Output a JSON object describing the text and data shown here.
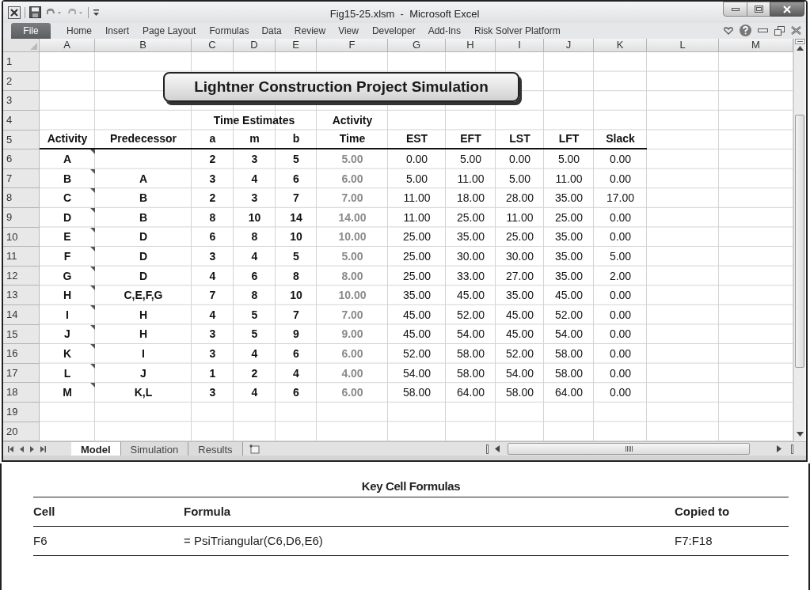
{
  "window": {
    "title": "Fig15-25.xlsm  -  Microsoft Excel"
  },
  "ribbon": {
    "file_tab": "File",
    "tabs": [
      "Home",
      "Insert",
      "Page Layout",
      "Formulas",
      "Data",
      "Review",
      "View",
      "Developer",
      "Add-Ins",
      "Risk Solver Platform"
    ]
  },
  "sheet": {
    "columns": [
      "A",
      "B",
      "C",
      "D",
      "E",
      "F",
      "G",
      "H",
      "I",
      "J",
      "K",
      "L",
      "M"
    ],
    "row_numbers": [
      "1",
      "2",
      "3",
      "4",
      "5",
      "6",
      "7",
      "8",
      "9",
      "10",
      "11",
      "12",
      "13",
      "14",
      "15",
      "16",
      "17",
      "18",
      "19",
      "20"
    ],
    "title_box": "Lightner Construction Project Simulation",
    "header_groups": [
      "Time Estimates",
      "Activity"
    ],
    "headers": [
      "Activity",
      "Predecessor",
      "a",
      "m",
      "b",
      "Time",
      "EST",
      "EFT",
      "LST",
      "LFT",
      "Slack"
    ],
    "data_rows": [
      {
        "activity": "A",
        "a": "2",
        "m": "3",
        "b": "5",
        "time": "5.00",
        "est": "0.00",
        "eft": "5.00",
        "lst": "0.00",
        "lft": "5.00",
        "slack": "0.00",
        "comment": true
      },
      {
        "activity": "B",
        "predecessor": "A",
        "a": "3",
        "m": "4",
        "b": "6",
        "time": "6.00",
        "est": "5.00",
        "eft": "11.00",
        "lst": "5.00",
        "lft": "11.00",
        "slack": "0.00",
        "comment": true
      },
      {
        "activity": "C",
        "predecessor": "B",
        "a": "2",
        "m": "3",
        "b": "7",
        "time": "7.00",
        "est": "11.00",
        "eft": "18.00",
        "lst": "28.00",
        "lft": "35.00",
        "slack": "17.00",
        "comment": true
      },
      {
        "activity": "D",
        "predecessor": "B",
        "a": "8",
        "m": "10",
        "b": "14",
        "time": "14.00",
        "est": "11.00",
        "eft": "25.00",
        "lst": "11.00",
        "lft": "25.00",
        "slack": "0.00",
        "comment": true
      },
      {
        "activity": "E",
        "predecessor": "D",
        "a": "6",
        "m": "8",
        "b": "10",
        "time": "10.00",
        "est": "25.00",
        "eft": "35.00",
        "lst": "25.00",
        "lft": "35.00",
        "slack": "0.00",
        "comment": true
      },
      {
        "activity": "F",
        "predecessor": "D",
        "a": "3",
        "m": "4",
        "b": "5",
        "time": "5.00",
        "est": "25.00",
        "eft": "30.00",
        "lst": "30.00",
        "lft": "35.00",
        "slack": "5.00",
        "comment": true
      },
      {
        "activity": "G",
        "predecessor": "D",
        "a": "4",
        "m": "6",
        "b": "8",
        "time": "8.00",
        "est": "25.00",
        "eft": "33.00",
        "lst": "27.00",
        "lft": "35.00",
        "slack": "2.00",
        "comment": true
      },
      {
        "activity": "H",
        "predecessor": "C,E,F,G",
        "a": "7",
        "m": "8",
        "b": "10",
        "time": "10.00",
        "est": "35.00",
        "eft": "45.00",
        "lst": "35.00",
        "lft": "45.00",
        "slack": "0.00",
        "comment": true
      },
      {
        "activity": "I",
        "predecessor": "H",
        "a": "4",
        "m": "5",
        "b": "7",
        "time": "7.00",
        "est": "45.00",
        "eft": "52.00",
        "lst": "45.00",
        "lft": "52.00",
        "slack": "0.00",
        "comment": true
      },
      {
        "activity": "J",
        "predecessor": "H",
        "a": "3",
        "m": "5",
        "b": "9",
        "time": "9.00",
        "est": "45.00",
        "eft": "54.00",
        "lst": "45.00",
        "lft": "54.00",
        "slack": "0.00",
        "comment": true
      },
      {
        "activity": "K",
        "predecessor": "I",
        "a": "3",
        "m": "4",
        "b": "6",
        "time": "6.00",
        "est": "52.00",
        "eft": "58.00",
        "lst": "52.00",
        "lft": "58.00",
        "slack": "0.00",
        "comment": true
      },
      {
        "activity": "L",
        "predecessor": "J",
        "a": "1",
        "m": "2",
        "b": "4",
        "time": "4.00",
        "est": "54.00",
        "eft": "58.00",
        "lst": "54.00",
        "lft": "58.00",
        "slack": "0.00",
        "comment": true
      },
      {
        "activity": "M",
        "predecessor": "K,L",
        "a": "3",
        "m": "4",
        "b": "6",
        "time": "6.00",
        "est": "58.00",
        "eft": "64.00",
        "lst": "58.00",
        "lft": "64.00",
        "slack": "0.00",
        "comment": true
      }
    ]
  },
  "sheet_tabs": [
    {
      "label": "Model",
      "selected": true
    },
    {
      "label": "Simulation",
      "selected": false
    },
    {
      "label": "Results",
      "selected": false
    }
  ],
  "formulas": {
    "title": "Key Cell Formulas",
    "columns": [
      "Cell",
      "Formula",
      "Copied to"
    ],
    "rows": [
      [
        "F6",
        "= PsiTriangular(C6,D6,E6)",
        "F7:F18"
      ]
    ]
  }
}
